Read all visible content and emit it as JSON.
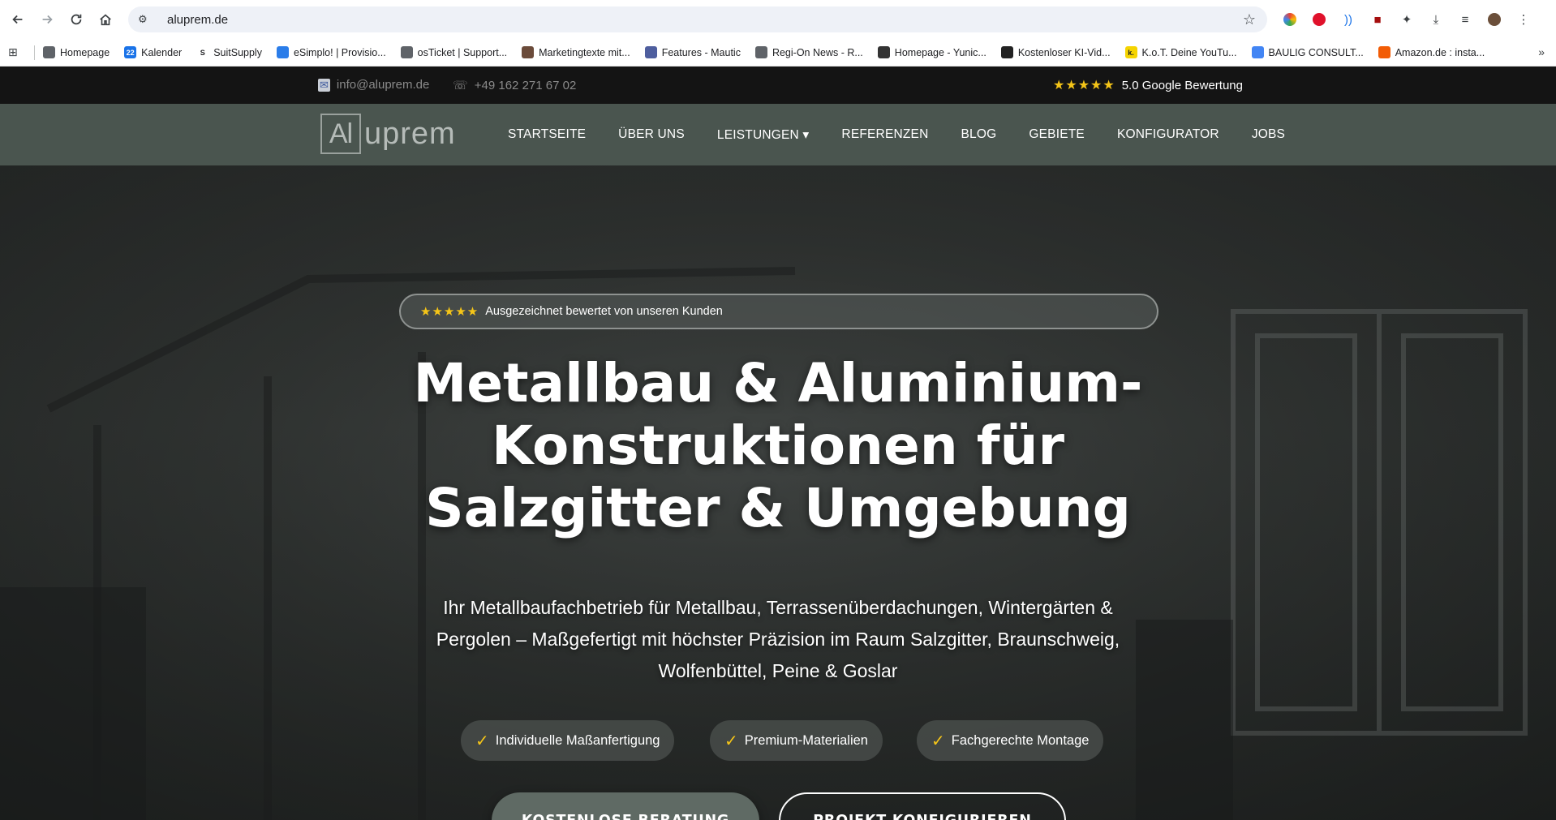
{
  "browser": {
    "url": "aluprem.de",
    "bookmarks": [
      {
        "label": "Homepage",
        "color": "#5f6368",
        "glyph": ""
      },
      {
        "label": "Kalender",
        "color": "#1a73e8",
        "glyph": "22"
      },
      {
        "label": "SuitSupply",
        "color": "#ffffff",
        "glyph": "S"
      },
      {
        "label": "eSimplo! | Provisio...",
        "color": "#2b7de9",
        "glyph": ""
      },
      {
        "label": "osTicket | Support...",
        "color": "#5f6368",
        "glyph": ""
      },
      {
        "label": "Marketingtexte mit...",
        "color": "#6b4b3a",
        "glyph": ""
      },
      {
        "label": "Features - Mautic",
        "color": "#4e5e9e",
        "glyph": ""
      },
      {
        "label": "Regi-On News - R...",
        "color": "#5f6368",
        "glyph": ""
      },
      {
        "label": "Homepage - Yunic...",
        "color": "#333333",
        "glyph": ""
      },
      {
        "label": "Kostenloser KI-Vid...",
        "color": "#222222",
        "glyph": ""
      },
      {
        "label": "K.o.T. Deine YouTu...",
        "color": "#f5d400",
        "glyph": "k."
      },
      {
        "label": "BAULIG CONSULT...",
        "color": "#4285f4",
        "glyph": ""
      },
      {
        "label": "Amazon.de : insta...",
        "color": "#f25c05",
        "glyph": ""
      }
    ]
  },
  "topbar": {
    "email": "info@aluprem.de",
    "phone": "+49 162 271 67 02",
    "rating_stars": "★★★★★",
    "rating_text": "5.0 Google Bewertung"
  },
  "nav": {
    "logo_box": "Al",
    "logo_rest": "uprem",
    "items": [
      "STARTSEITE",
      "ÜBER UNS",
      "LEISTUNGEN ▾",
      "REFERENZEN",
      "BLOG",
      "GEBIETE",
      "KONFIGURATOR",
      "JOBS"
    ]
  },
  "hero": {
    "badge_stars": "★★★★★",
    "badge_text": "Ausgezeichnet bewertet von unseren Kunden",
    "headline_line1": "Metallbau & Aluminium-",
    "headline_line2": "Konstruktionen für",
    "headline_line3": "Salzgitter & Umgebung",
    "subline": "Ihr Metallbaufachbetrieb für Metallbau, Terrassenüberdachungen, Wintergärten & Pergolen – Maßgefertigt mit höchster Präzision im Raum Salzgitter, Braunschweig, Wolfenbüttel, Peine & Goslar",
    "features": [
      "Individuelle Maßanfertigung",
      "Premium-Materialien",
      "Fachgerechte Montage"
    ],
    "check_glyph": "✓",
    "cta_primary": "KOSTENLOSE BERATUNG",
    "cta_secondary": "PROJEKT KONFIGURIEREN"
  },
  "colors": {
    "topbar_bg": "#141414",
    "nav_bg": "#4a554f",
    "star": "#f5c518",
    "cta_primary_bg": "#5f6a64"
  }
}
